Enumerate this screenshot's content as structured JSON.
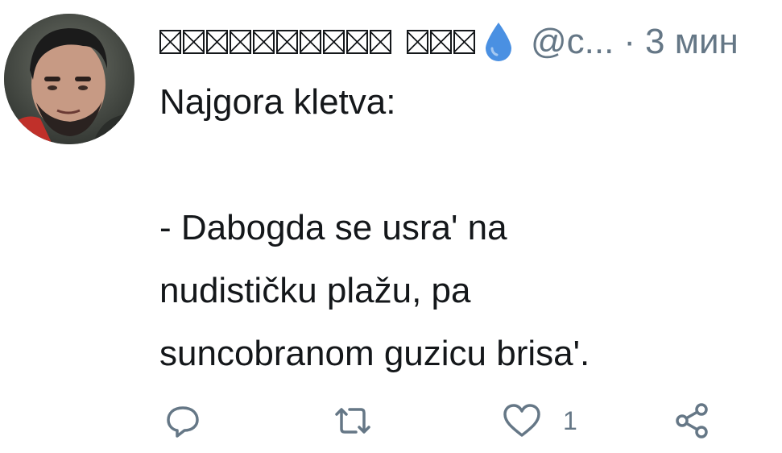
{
  "tweet": {
    "author": {
      "display_name_obscured": "▯▯▯▯▯▯▯▯▯▯ ▯▯▯",
      "emoji_icon": "droplet-icon",
      "handle": "@c...",
      "avatar": "profile-photo"
    },
    "separator": "·",
    "time": "3 мин",
    "text_lines": [
      "Najgora kletva:",
      "",
      "- Dabogda se usra' na",
      "nudističku plažu, pa",
      "suncobranom guzicu brisa'."
    ],
    "actions": {
      "reply_icon": "reply-icon",
      "retweet_icon": "retweet-icon",
      "like_icon": "heart-icon",
      "like_count": "1",
      "share_icon": "share-icon"
    },
    "colors": {
      "text": "#14171a",
      "muted": "#657786",
      "droplet": "#4a90e2"
    }
  }
}
